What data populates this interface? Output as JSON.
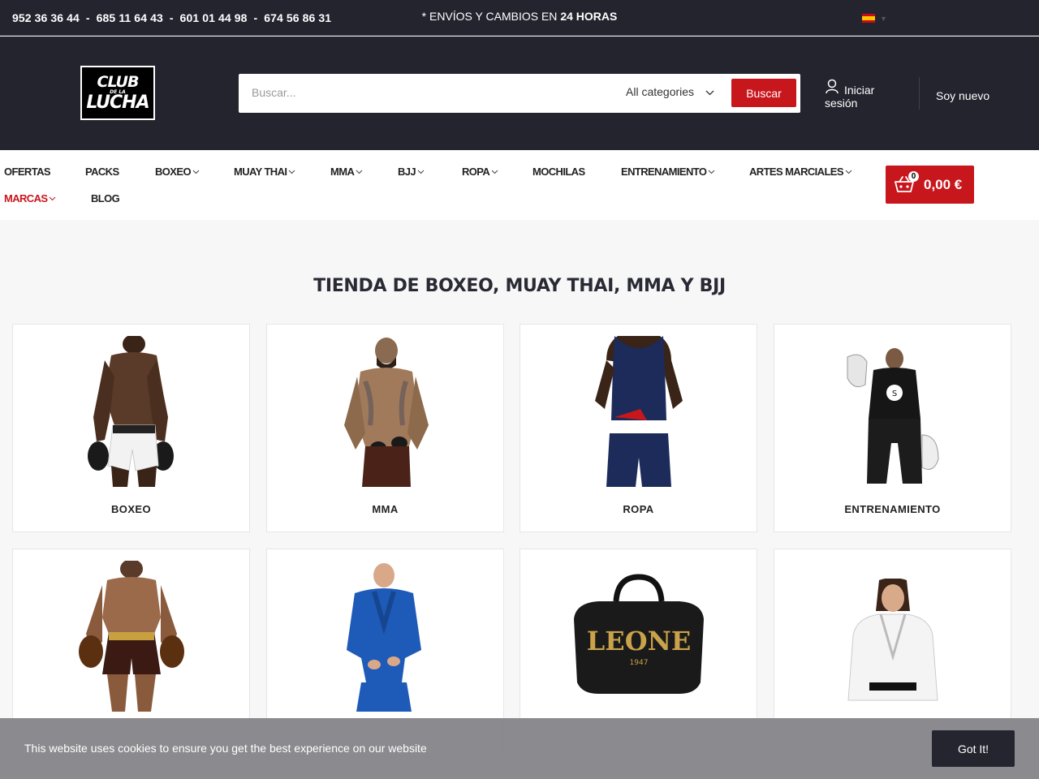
{
  "topbar": {
    "phones": "952 36 36 44  -  685 11 64 43  -  601 01 44 98  -  674 56 86 31",
    "shipping_prefix": "* ENVÍOS Y CAMBIOS EN ",
    "shipping_bold": "24 HORAS",
    "language_flag": "spain-flag-icon"
  },
  "header": {
    "logo_line1": "CLUB",
    "logo_line2": "DE LA",
    "logo_line3": "LUCHA",
    "search_placeholder": "Buscar...",
    "category_select": "All categories",
    "search_button": "Buscar",
    "login_line1": "Iniciar",
    "login_line2": "sesión",
    "register": "Soy nuevo"
  },
  "nav": {
    "items": [
      {
        "label": "OFERTAS"
      },
      {
        "label": "PACKS"
      },
      {
        "label": "BOXEO"
      },
      {
        "label": "MUAY THAI"
      },
      {
        "label": "MMA"
      },
      {
        "label": "BJJ"
      },
      {
        "label": "ROPA"
      },
      {
        "label": "MOCHILAS"
      },
      {
        "label": "ENTRENAMIENTO"
      },
      {
        "label": "ARTES MARCIALES"
      },
      {
        "label": "MARCAS"
      },
      {
        "label": "BLOG"
      }
    ],
    "cart_count": "0",
    "cart_total": "0,00 €",
    "accent": "#c8161d"
  },
  "main": {
    "title": "TIENDA DE BOXEO, MUAY THAI, MMA Y BJJ",
    "cards": [
      {
        "label": "BOXEO"
      },
      {
        "label": "MMA"
      },
      {
        "label": "ROPA"
      },
      {
        "label": "ENTRENAMIENTO"
      },
      {
        "label": ""
      },
      {
        "label": ""
      },
      {
        "label": ""
      },
      {
        "label": ""
      }
    ],
    "bag_brand": "LEONE",
    "bag_year": "1947"
  },
  "cookie": {
    "text": "This website uses cookies to ensure you get the best experience on our website",
    "button": "Got It!"
  }
}
